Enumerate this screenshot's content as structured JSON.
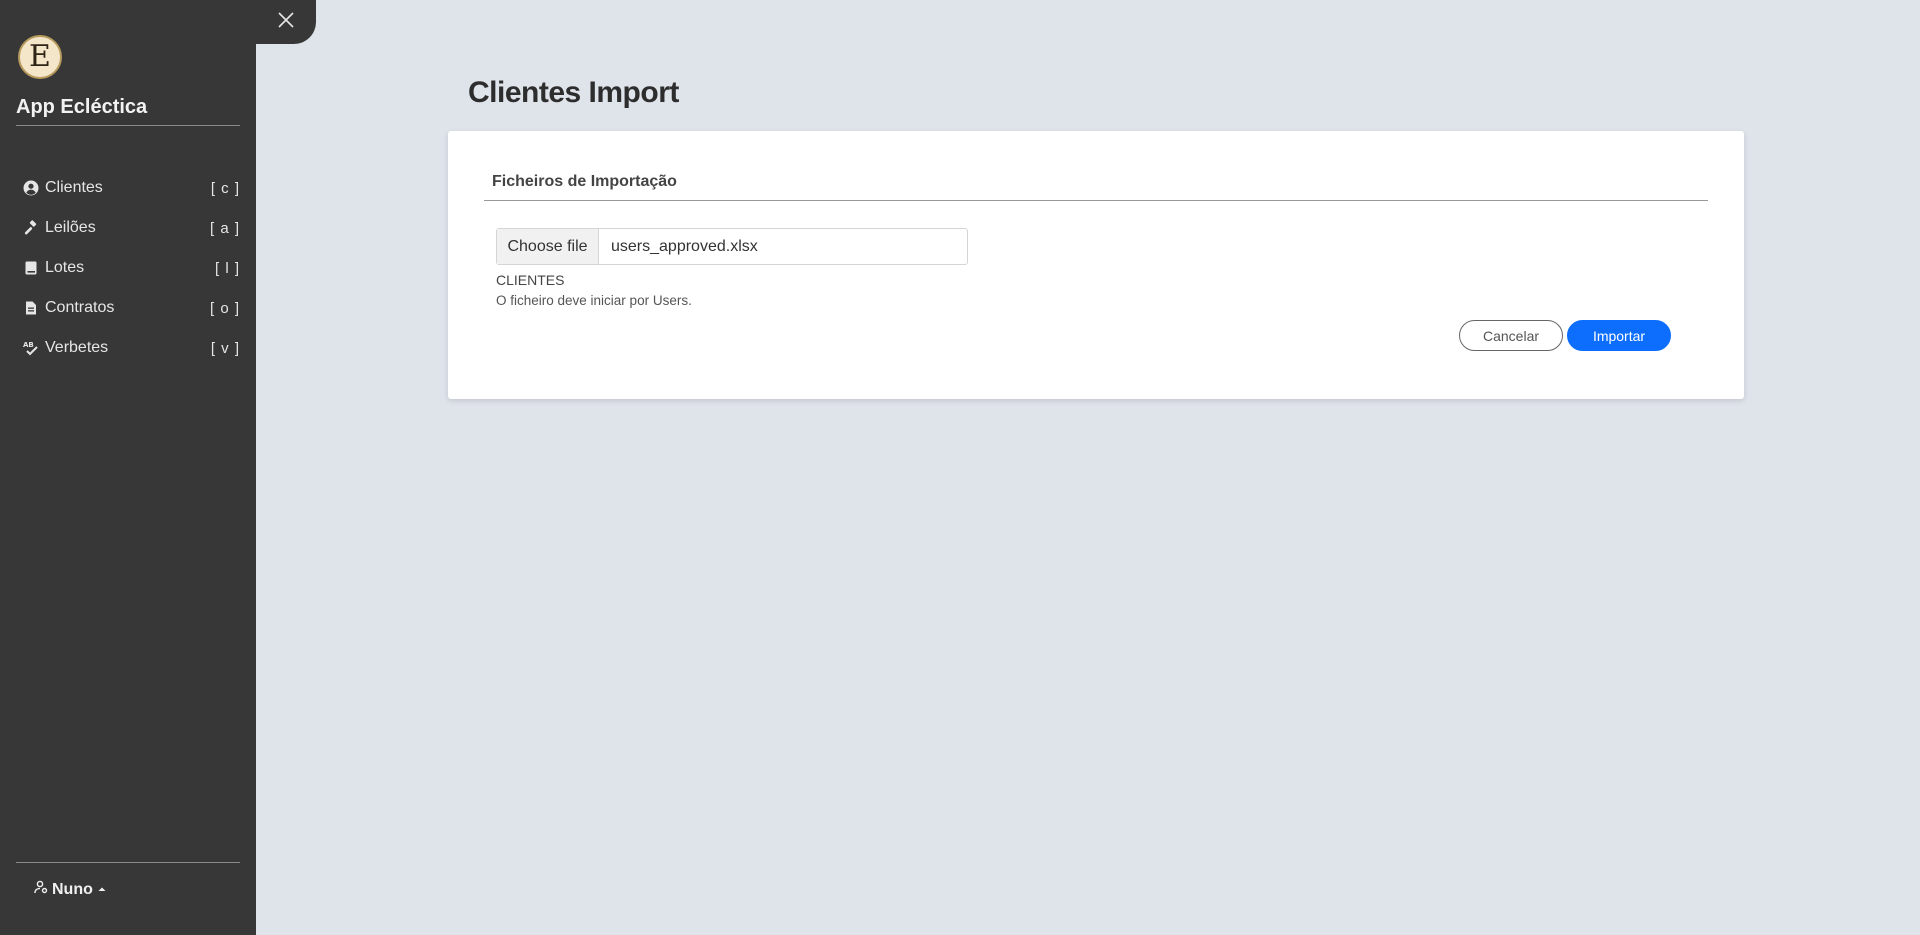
{
  "app": {
    "title": "App Ecléctica",
    "logo_letter": "E"
  },
  "sidebar": {
    "items": [
      {
        "label": "Clientes",
        "shortcut": "[ c ]",
        "icon": "user-circle-icon"
      },
      {
        "label": "Leilões",
        "shortcut": "[ a ]",
        "icon": "gavel-icon"
      },
      {
        "label": "Lotes",
        "shortcut": "[ l ]",
        "icon": "book-icon"
      },
      {
        "label": "Contratos",
        "shortcut": "[ o ]",
        "icon": "document-icon"
      },
      {
        "label": "Verbetes",
        "shortcut": "[ v ]",
        "icon": "spellcheck-icon"
      }
    ],
    "user": {
      "name": "Nuno"
    }
  },
  "page": {
    "title": "Clientes Import"
  },
  "card": {
    "header": "Ficheiros de Importação",
    "file_input": {
      "button_label": "Choose file",
      "file_name": "users_approved.xlsx"
    },
    "section_label": "CLIENTES",
    "hint": "O ficheiro deve iniciar por Users.",
    "cancel_label": "Cancelar",
    "import_label": "Importar"
  },
  "colors": {
    "sidebar_bg": "#373737",
    "page_bg": "#dfe3ea",
    "primary": "#0d6efd"
  }
}
